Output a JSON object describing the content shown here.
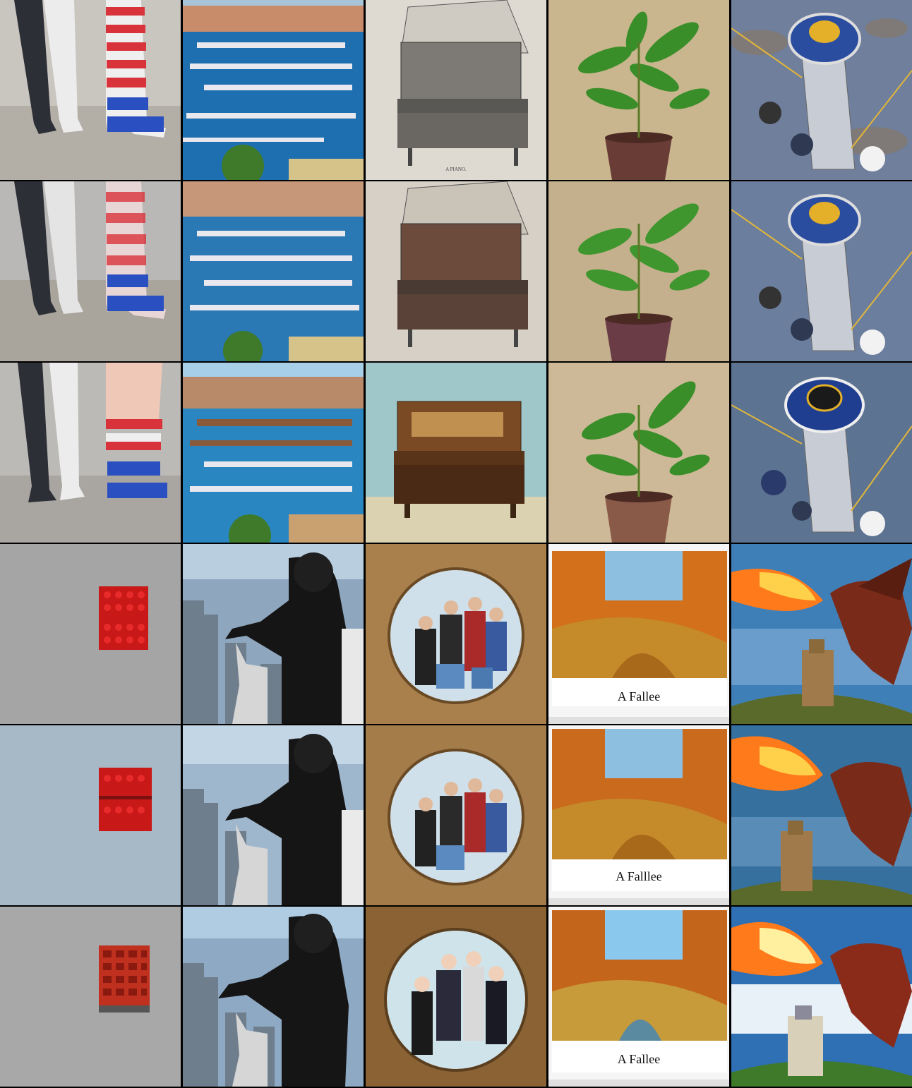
{
  "grid": {
    "columns": [
      "socks",
      "marina",
      "piano",
      "plant",
      "space-station"
    ],
    "columns_bottom": [
      "lego-brick",
      "gorilla",
      "family-portrait",
      "autumn-forest",
      "dragon-castle"
    ]
  },
  "piano_plate_text": "A PIANO.",
  "forest_captions": [
    "A Fallee",
    "A Falllee",
    "A   Fallee"
  ],
  "colors": {
    "sock_red": "#d8323a",
    "sock_blue": "#2a4fc0",
    "sea": "#1e6fb0",
    "plant_green": "#3a8e2a",
    "pot": "#6a3c36",
    "wall_beige": "#c9b68e",
    "brick_red": "#c81818",
    "forest_orange": "#d2701c",
    "sky_blue": "#3f7fb8",
    "fire": "#ff7a1a"
  }
}
